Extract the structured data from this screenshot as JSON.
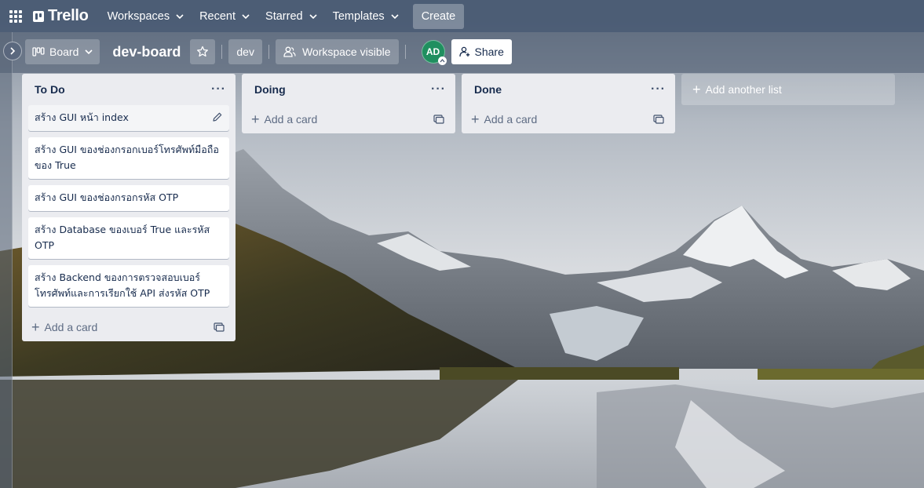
{
  "app": {
    "logo_text": "Trello"
  },
  "topnav": {
    "workspaces": "Workspaces",
    "recent": "Recent",
    "starred": "Starred",
    "templates": "Templates",
    "create": "Create"
  },
  "board_header": {
    "view_label": "Board",
    "title": "dev-board",
    "workspace_name": "dev",
    "visibility": "Workspace visible",
    "member_initials": "AD",
    "share_label": "Share"
  },
  "lists": [
    {
      "title": "To Do",
      "cards": [
        "สร้าง GUI หน้า index",
        "สร้าง GUI ของช่องกรอกเบอร์โทรศัพท์มือถือของ True",
        "สร้าง GUI ของช่องกรอกรหัส OTP",
        "สร้าง Database ของเบอร์ True และรหัส OTP",
        "สร้าง Backend ของการตรวจสอบเบอร์โทรศัพท์และการเรียกใช้ API ส่งรหัส OTP"
      ],
      "add_card": "Add a card"
    },
    {
      "title": "Doing",
      "cards": [],
      "add_card": "Add a card"
    },
    {
      "title": "Done",
      "cards": [],
      "add_card": "Add a card"
    }
  ],
  "add_list_label": "Add another list",
  "colors": {
    "nav_bg": "#485972",
    "list_bg": "#ebecf0",
    "text": "#172b4d",
    "avatar": "#1f8f5f"
  }
}
